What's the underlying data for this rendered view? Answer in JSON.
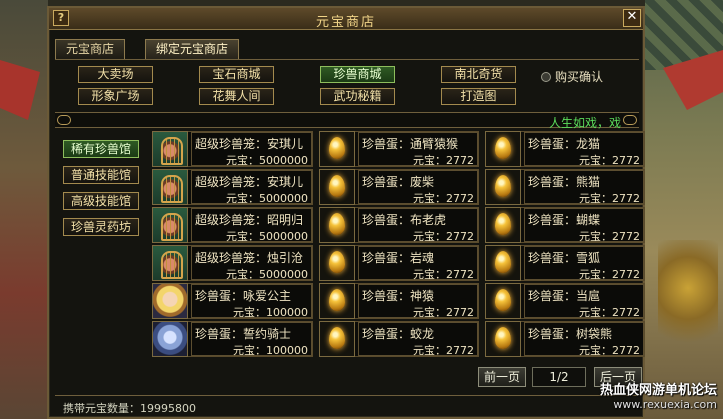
{
  "window": {
    "title": "元宝商店",
    "help_glyph": "?",
    "close_glyph": "✕"
  },
  "outer_tabs": [
    {
      "label": "元宝商店"
    },
    {
      "label": "绑定元宝商店"
    }
  ],
  "categories": [
    {
      "label": "大卖场"
    },
    {
      "label": "宝石商城"
    },
    {
      "label": "珍兽商城",
      "active": true
    },
    {
      "label": "南北奇货"
    },
    {
      "label": "形象广场"
    },
    {
      "label": "花舞人间"
    },
    {
      "label": "武功秘籍"
    },
    {
      "label": "打造图"
    }
  ],
  "purchase_confirm": {
    "label": "购买确认"
  },
  "banner": {
    "text": "人生如戏，戏"
  },
  "side_tabs": [
    {
      "label": "稀有珍兽馆",
      "active": true
    },
    {
      "label": "普通技能馆"
    },
    {
      "label": "高级技能馆"
    },
    {
      "label": "珍兽灵药坊"
    }
  ],
  "items": [
    {
      "icon": "cage-icon",
      "name": "超级珍兽笼：安琪儿",
      "price": "元宝：5000000"
    },
    {
      "icon": "egg-icon",
      "name": "珍兽蛋：通臂猿猴",
      "price": "元宝：2772"
    },
    {
      "icon": "egg-icon",
      "name": "珍兽蛋：龙猫",
      "price": "元宝：2772"
    },
    {
      "icon": "cage-icon",
      "name": "超级珍兽笼：安琪儿",
      "price": "元宝：5000000"
    },
    {
      "icon": "egg-icon",
      "name": "珍兽蛋：废柴",
      "price": "元宝：2772"
    },
    {
      "icon": "egg-icon",
      "name": "珍兽蛋：熊猫",
      "price": "元宝：2772"
    },
    {
      "icon": "cage-icon",
      "name": "超级珍兽笼：昭明归",
      "price": "元宝：5000000"
    },
    {
      "icon": "egg-icon",
      "name": "珍兽蛋：布老虎",
      "price": "元宝：2772"
    },
    {
      "icon": "egg-icon",
      "name": "珍兽蛋：蝴蝶",
      "price": "元宝：2772"
    },
    {
      "icon": "cage-icon",
      "name": "超级珍兽笼：烛引沧",
      "price": "元宝：5000000"
    },
    {
      "icon": "egg-icon",
      "name": "珍兽蛋：岩魂",
      "price": "元宝：2772"
    },
    {
      "icon": "egg-icon",
      "name": "珍兽蛋：雪狐",
      "price": "元宝：2772"
    },
    {
      "icon": "fairy-icon",
      "name": "珍兽蛋：咏爱公主",
      "price": "元宝：100000"
    },
    {
      "icon": "egg-icon",
      "name": "珍兽蛋：神猿",
      "price": "元宝：2772"
    },
    {
      "icon": "egg-icon",
      "name": "珍兽蛋：当扈",
      "price": "元宝：2772"
    },
    {
      "icon": "knight-icon",
      "name": "珍兽蛋：誓约骑士",
      "price": "元宝：100000"
    },
    {
      "icon": "egg-icon",
      "name": "珍兽蛋：蛟龙",
      "price": "元宝：2772"
    },
    {
      "icon": "egg-icon",
      "name": "珍兽蛋：树袋熊",
      "price": "元宝：2772"
    }
  ],
  "pagination": {
    "prev": "前一页",
    "indicator": "1/2",
    "next": "后一页"
  },
  "status": {
    "yuanbao": "携带元宝数量：19995800"
  },
  "watermark": {
    "line1": "热血侠网游单机论坛",
    "line2": "www.rexuexia.com"
  }
}
